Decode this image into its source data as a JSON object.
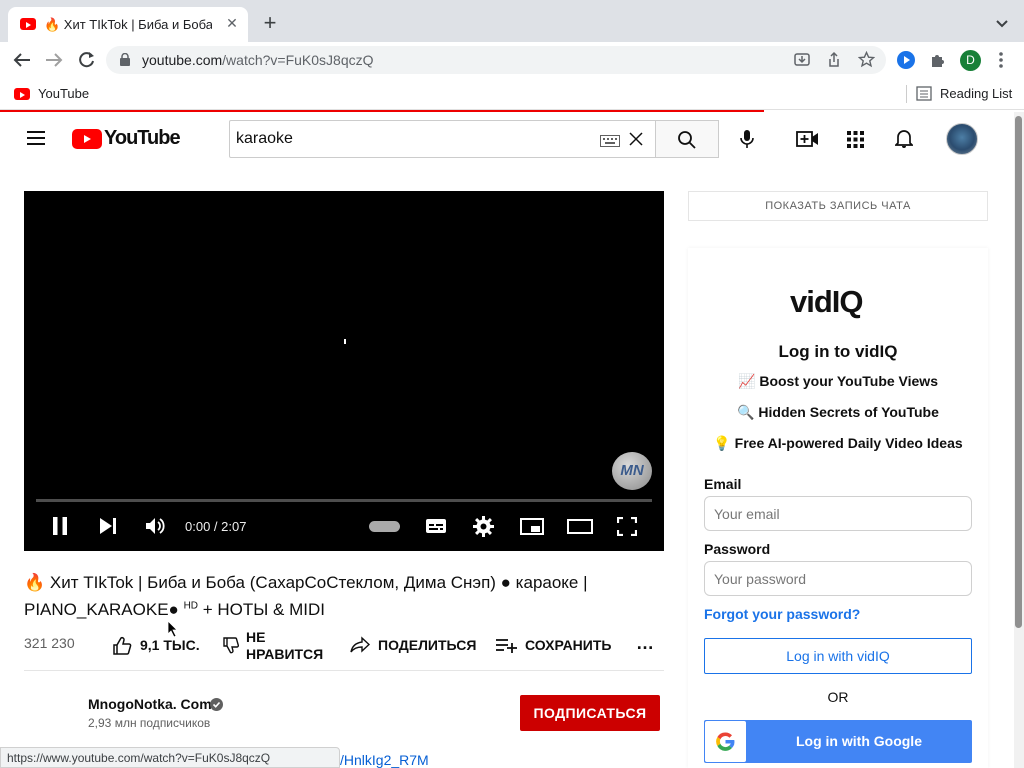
{
  "browser": {
    "tab_title": "🔥 Хит TIkTok | Биба и Боба (",
    "url_host": "youtube.com",
    "url_path": "/watch?v=FuK0sJ8qczQ",
    "bookmark_youtube": "YouTube",
    "reading_list": "Reading List",
    "profile_initial": "D",
    "status_url": "https://www.youtube.com/watch?v=FuK0sJ8qczQ"
  },
  "header": {
    "logo_text": "YouTube",
    "search_value": "karaoke"
  },
  "player": {
    "time": "0:00 / 2:07",
    "watermark": "MN"
  },
  "video": {
    "title_line1": "🔥 Хит TIkTok | Биба и Боба (СахарСоСтеклом, Дима Снэп) ● караоке |",
    "title_line2a": "PIANO_KARAOKE●",
    "title_hd": "HD",
    "title_line2b": "+ НОТЫ & MIDI",
    "views": "321 230",
    "likes": "9,1 ТЫС.",
    "dislike_l1": "НЕ",
    "dislike_l2": "НРАВИТСЯ",
    "share": "ПОДЕЛИТЬСЯ",
    "save": "СОХРАНИТЬ",
    "more": "…",
    "channel_name": "MnogoNotka. Com",
    "subscribers": "2,93 млн подписчиков",
    "subscribe": "ПОДПИСАТЬСЯ",
    "desc_link": "/HnlkIg2_R7M"
  },
  "sidebar": {
    "chat_button": "ПОКАЗАТЬ ЗАПИСЬ ЧАТА"
  },
  "vidiq": {
    "logo": "vidIQ",
    "heading": "Log in to vidIQ",
    "features": [
      {
        "icon": "📈",
        "text": "Boost your YouTube Views"
      },
      {
        "icon": "🔍",
        "text": "Hidden Secrets of YouTube"
      },
      {
        "icon": "💡",
        "text": "Free AI-powered Daily Video Ideas"
      }
    ],
    "email_label": "Email",
    "email_placeholder": "Your email",
    "password_label": "Password",
    "password_placeholder": "Your password",
    "forgot": "Forgot your password?",
    "login_button": "Log in with vidIQ",
    "or": "OR",
    "google_button": "Log in with Google"
  },
  "colors": {
    "youtube_red": "#ff0000",
    "subscribe_red": "#cc0000",
    "vidiq_blue": "#1a73e8",
    "google_blue": "#4285f4"
  }
}
